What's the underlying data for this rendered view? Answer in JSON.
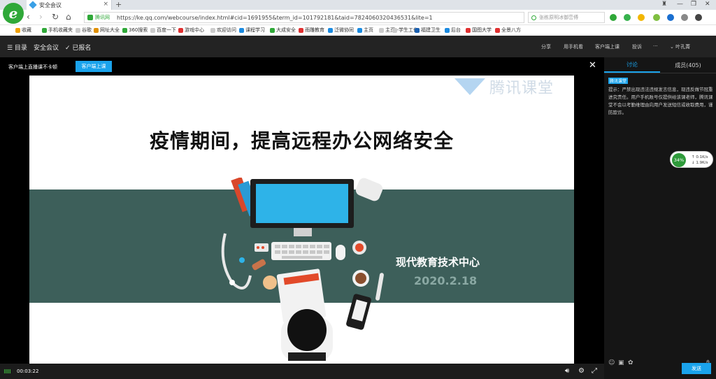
{
  "browser": {
    "tab_title": "安全会议",
    "tab_close": "×",
    "new_tab": "+",
    "address_label": "腾讯网",
    "url": "https://ke.qq.com/webcourse/index.html#cid=1691955&term_id=101792181&taid=7824060320436531&lite=1",
    "search_placeholder": "张栋原明冰御峦傅"
  },
  "bookmarks": [
    {
      "label": "收藏",
      "color": "#f0a000"
    },
    {
      "label": "手机收藏夹",
      "color": "#2fa838"
    },
    {
      "label": "谷歌",
      "color": "#cccccc"
    },
    {
      "label": "网址大全",
      "color": "#e09000"
    },
    {
      "label": "360搜索",
      "color": "#2fa838"
    },
    {
      "label": "百度一下",
      "color": "#cccccc"
    },
    {
      "label": "游戏中心",
      "color": "#e03030"
    },
    {
      "label": "欢迎访问",
      "color": "#cccccc"
    },
    {
      "label": "课程学习",
      "color": "#1a8ae0"
    },
    {
      "label": "大成安全",
      "color": "#2fa838"
    },
    {
      "label": "雨雕教育",
      "color": "#e03030"
    },
    {
      "label": "泛微协同",
      "color": "#1a8ae0"
    },
    {
      "label": "主页",
      "color": "#1a8ae0"
    },
    {
      "label": "主页 -",
      "color": "#cccccc"
    },
    {
      "label": "学生工作",
      "color": "#cccccc"
    },
    {
      "label": "福建卫生",
      "color": "#1a60b0"
    },
    {
      "label": "后台",
      "color": "#1a8ae0"
    },
    {
      "label": "国图大学",
      "color": "#e03030"
    },
    {
      "label": "全景八方",
      "color": "#e03030"
    }
  ],
  "app_header": {
    "menu": "☰ 目录",
    "meeting": "安全会议",
    "signed": "✓ 已报名",
    "share": "分享",
    "mobile": "用手机看",
    "client": "客户端上课",
    "complain": "投诉",
    "more": "···",
    "user": "⌄ 叶孔菁"
  },
  "video": {
    "notice": "客户端上直播课不卡顿",
    "client_button": "客户端上课",
    "close": "✕",
    "time": "00:03:22"
  },
  "slide": {
    "brand": "腾讯课堂",
    "title": "疫情期间，提高远程办公网络安全",
    "center_name": "现代教育技术中心",
    "date": "2020.2.18"
  },
  "side": {
    "tab_discuss": "讨论",
    "tab_members": "成员(405)",
    "notice_tag": "腾讯课堂",
    "notice_text": "提示：严禁出现违法违规发言信息，现违反做节冠重进究责任。用户手机账号仅提供给该课老师，腾讯课堂不会以考勤维理由向用户发送短信或收取费用，谨防欺诈。",
    "network": {
      "percent": "34%",
      "up": "↑  0.1K/s",
      "down": "↓  1.9K/s"
    },
    "send": "发送"
  }
}
